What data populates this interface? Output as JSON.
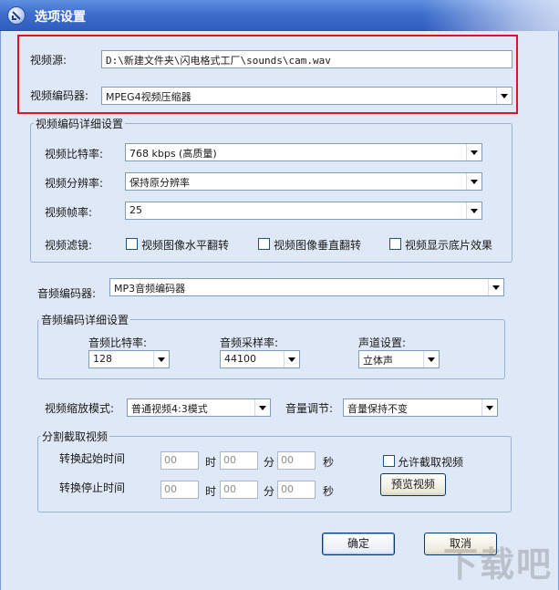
{
  "window": {
    "title": "选项设置"
  },
  "video_source": {
    "label": "视频源:",
    "value": "D:\\新建文件夹\\闪电格式工厂\\sounds\\cam.wav"
  },
  "video_encoder": {
    "label": "视频编码器:",
    "value": "MPEG4视频压缩器"
  },
  "video_detail": {
    "title": "视频编码详细设置",
    "bitrate_label": "视频比特率:",
    "bitrate_value": "768 kbps (高质量)",
    "resolution_label": "视频分辨率:",
    "resolution_value": "保持原分辨率",
    "framerate_label": "视频帧率:",
    "framerate_value": "25",
    "filter_label": "视频滤镜:",
    "filters": [
      "视频图像水平翻转",
      "视频图像垂直翻转",
      "视频显示底片效果"
    ]
  },
  "audio_encoder": {
    "label": "音频编码器:",
    "value": "MP3音频编码器"
  },
  "audio_detail": {
    "title": "音频编码详细设置",
    "bitrate_label": "音频比特率:",
    "bitrate_value": "128",
    "samplerate_label": "音频采样率:",
    "samplerate_value": "44100",
    "channel_label": "声道设置:",
    "channel_value": "立体声"
  },
  "scale_mode": {
    "label": "视频缩放模式:",
    "value": "普通视频4:3模式"
  },
  "volume": {
    "label": "音量调节:",
    "value": "音量保持不变"
  },
  "clip": {
    "title": "分割截取视频",
    "start_label": "转换起始时间",
    "end_label": "转换停止时间",
    "hour_unit": "时",
    "minute_unit": "分",
    "second_unit": "秒",
    "start_h": "00",
    "start_m": "00",
    "start_s": "00",
    "end_h": "00",
    "end_m": "00",
    "end_s": "00",
    "allow_label": "允许截取视频",
    "preview_label": "预览视频"
  },
  "buttons": {
    "ok": "确定",
    "cancel": "取消"
  },
  "watermark": "下载吧"
}
